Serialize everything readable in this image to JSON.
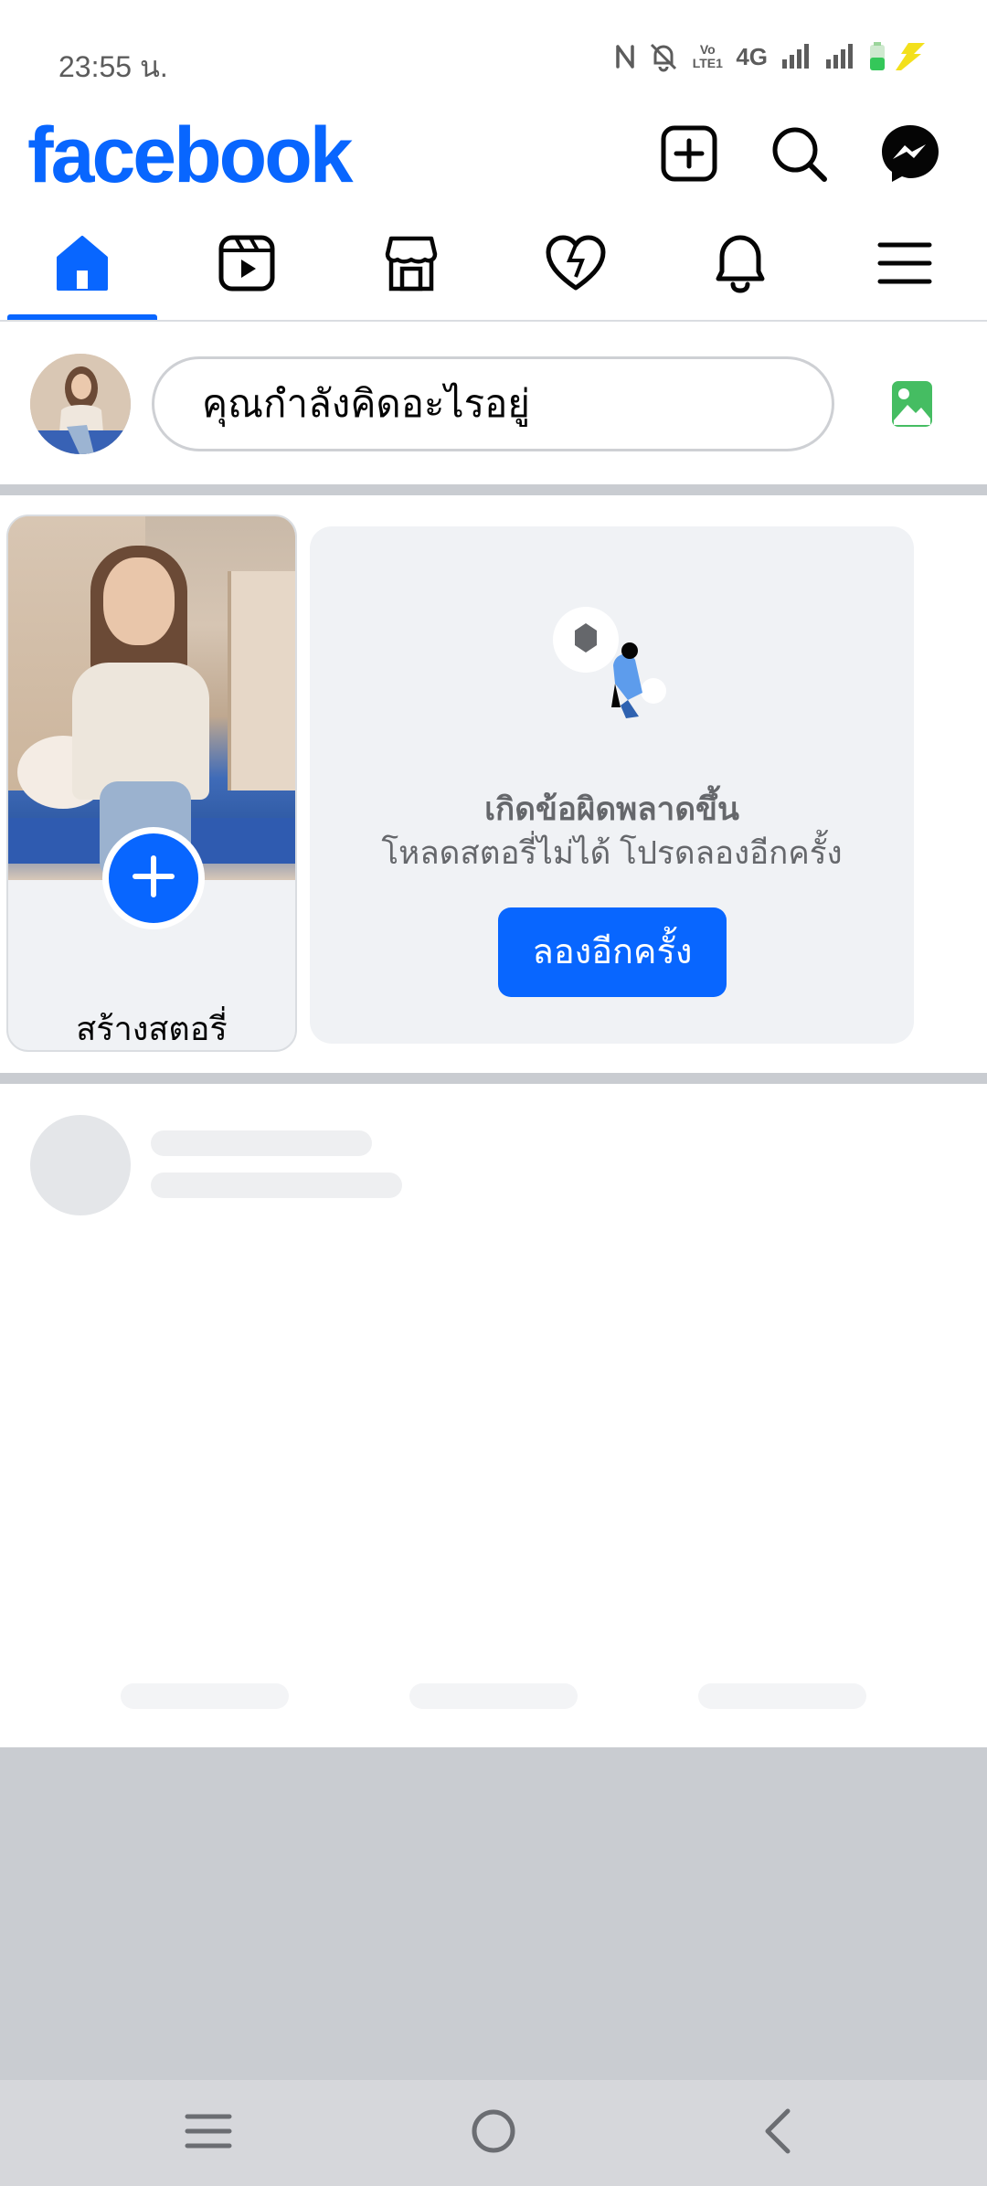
{
  "status_bar": {
    "time": "23:55 น.",
    "network": "4G",
    "volte": "Vo LTE1",
    "icons": [
      "nfc-icon",
      "mute-icon",
      "volte-icon",
      "signal-icon",
      "signal-icon",
      "battery-charging-icon"
    ]
  },
  "header": {
    "logo": "facebook",
    "buttons": [
      "create-icon",
      "search-icon",
      "messenger-icon"
    ]
  },
  "nav": {
    "tabs": [
      "home-icon",
      "video-icon",
      "marketplace-icon",
      "dating-icon",
      "notifications-icon",
      "menu-icon"
    ],
    "active": "home-icon"
  },
  "composer": {
    "placeholder": "คุณกำลังคิดอะไรอยู่",
    "photo_icon": "photo-icon"
  },
  "stories": {
    "create_label": "สร้างสตอรี่",
    "error_title": "เกิดข้อผิดพลาดขึ้น",
    "error_message": "โหลดสตอรี่ไม่ได้ โปรดลองอีกครั้ง",
    "retry_label": "ลองอีกครั้ง"
  },
  "system_nav": {
    "buttons": [
      "recents-icon",
      "home-circle-icon",
      "back-icon"
    ]
  },
  "colors": {
    "brand": "#0866ff",
    "photo_green": "#45bd62",
    "divider": "#c9ccd1"
  }
}
